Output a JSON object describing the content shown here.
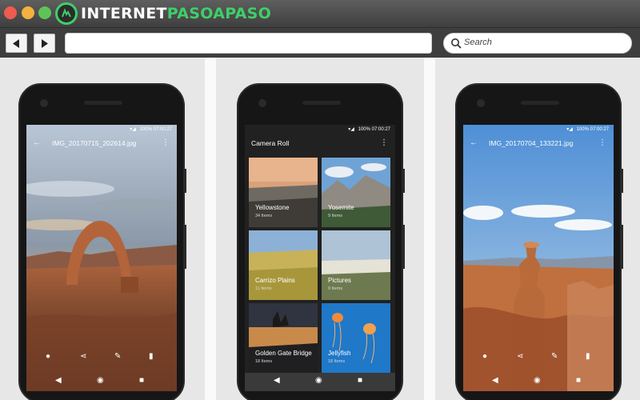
{
  "browser": {
    "logo": {
      "prefix": "INTERNET",
      "suffix": "PASOAPASO"
    },
    "search_placeholder": "Search",
    "url": ""
  },
  "status_bar": {
    "battery": "100%",
    "time": "07:00:27"
  },
  "phones": [
    {
      "screen": "photo-viewer",
      "title": "IMG_20170715_202614.jpg",
      "actions": [
        "info-icon",
        "share-icon",
        "edit-icon",
        "delete-icon"
      ]
    },
    {
      "screen": "album-grid",
      "title": "Camera Roll",
      "albums": [
        {
          "name": "Yellowstone",
          "count": "34 Items"
        },
        {
          "name": "Yosemite",
          "count": "9 Items"
        },
        {
          "name": "Carrizo Plains",
          "count": "11 Items"
        },
        {
          "name": "Pictures",
          "count": "9 Items"
        },
        {
          "name": "Golden Gate Bridge",
          "count": "18 Items"
        },
        {
          "name": "Jellyfish",
          "count": "18 Items"
        }
      ]
    },
    {
      "screen": "photo-viewer",
      "title": "IMG_20170704_133221.jpg",
      "actions": [
        "info-icon",
        "share-icon",
        "edit-icon",
        "delete-icon"
      ]
    }
  ],
  "colors": {
    "logo_green": "#3ecf6a",
    "chrome_dark": "#3e3e3e",
    "app_bar_dark": "#212121"
  }
}
